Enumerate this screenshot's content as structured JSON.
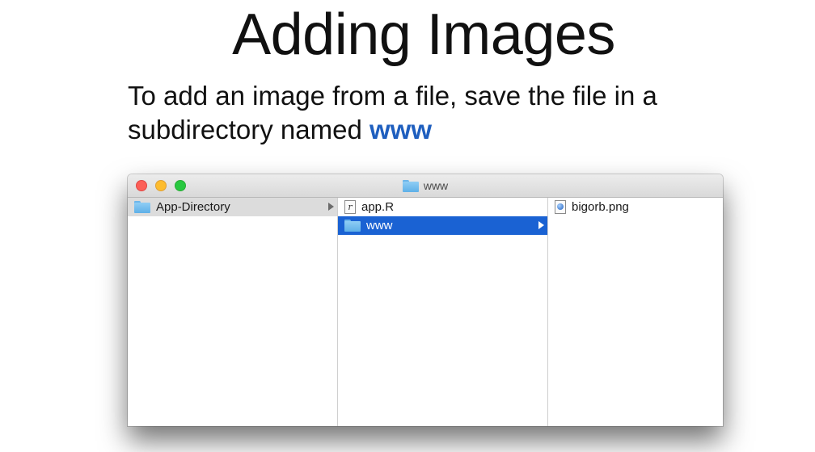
{
  "slide": {
    "title": "Adding Images",
    "body_before": "To add an image from a file, save the file in a subdirectory named ",
    "body_highlight": "www"
  },
  "finder": {
    "window_title": "www",
    "columns": [
      {
        "items": [
          {
            "label": "App-Directory",
            "icon": "folder-icon",
            "has_children": true,
            "state": "parent-selected"
          }
        ]
      },
      {
        "items": [
          {
            "label": "app.R",
            "icon": "script-file-icon",
            "has_children": false,
            "state": "normal"
          },
          {
            "label": "www",
            "icon": "folder-icon",
            "has_children": true,
            "state": "selected"
          }
        ]
      },
      {
        "items": [
          {
            "label": "bigorb.png",
            "icon": "image-file-icon",
            "has_children": false,
            "state": "normal"
          }
        ]
      }
    ],
    "colors": {
      "selection": "#1a62d3",
      "highlight_text": "#1f5fbf"
    }
  }
}
